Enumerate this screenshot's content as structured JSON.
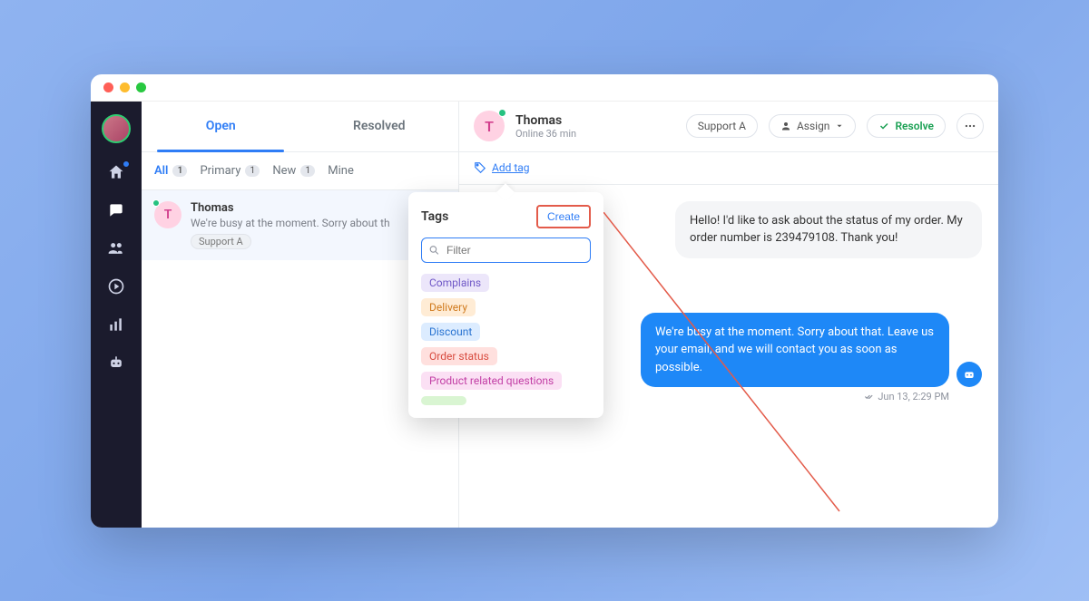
{
  "tabs": {
    "open": "Open",
    "resolved": "Resolved"
  },
  "subtabs": {
    "all": {
      "label": "All",
      "count": "1"
    },
    "primary": {
      "label": "Primary",
      "count": "1"
    },
    "new": {
      "label": "New",
      "count": "1"
    },
    "mine": {
      "label": "Mine"
    }
  },
  "conversation": {
    "avatar_initial": "T",
    "name": "Thomas",
    "snippet": "We're busy at the moment. Sorry about th",
    "chip": "Support A"
  },
  "chat_header": {
    "avatar_initial": "T",
    "name": "Thomas",
    "status": "Online 36 min",
    "support_pill": "Support A",
    "assign_label": "Assign",
    "resolve_label": "Resolve"
  },
  "tag_row": {
    "add_tag": "Add tag"
  },
  "popover": {
    "title": "Tags",
    "create": "Create",
    "filter_placeholder": "Filter",
    "tags": {
      "complains": "Complains",
      "delivery": "Delivery",
      "discount": "Discount",
      "order_status": "Order status",
      "product": "Product related questions"
    }
  },
  "messages": {
    "incoming": "Hello! I'd like to ask about the status of my order. My order number is 239479108. Thank you!",
    "outgoing": "We're busy at the moment. Sorry about that. Leave us your email, and we will contact you as soon as possible.",
    "out_timestamp": "Jun 13, 2:29 PM"
  }
}
